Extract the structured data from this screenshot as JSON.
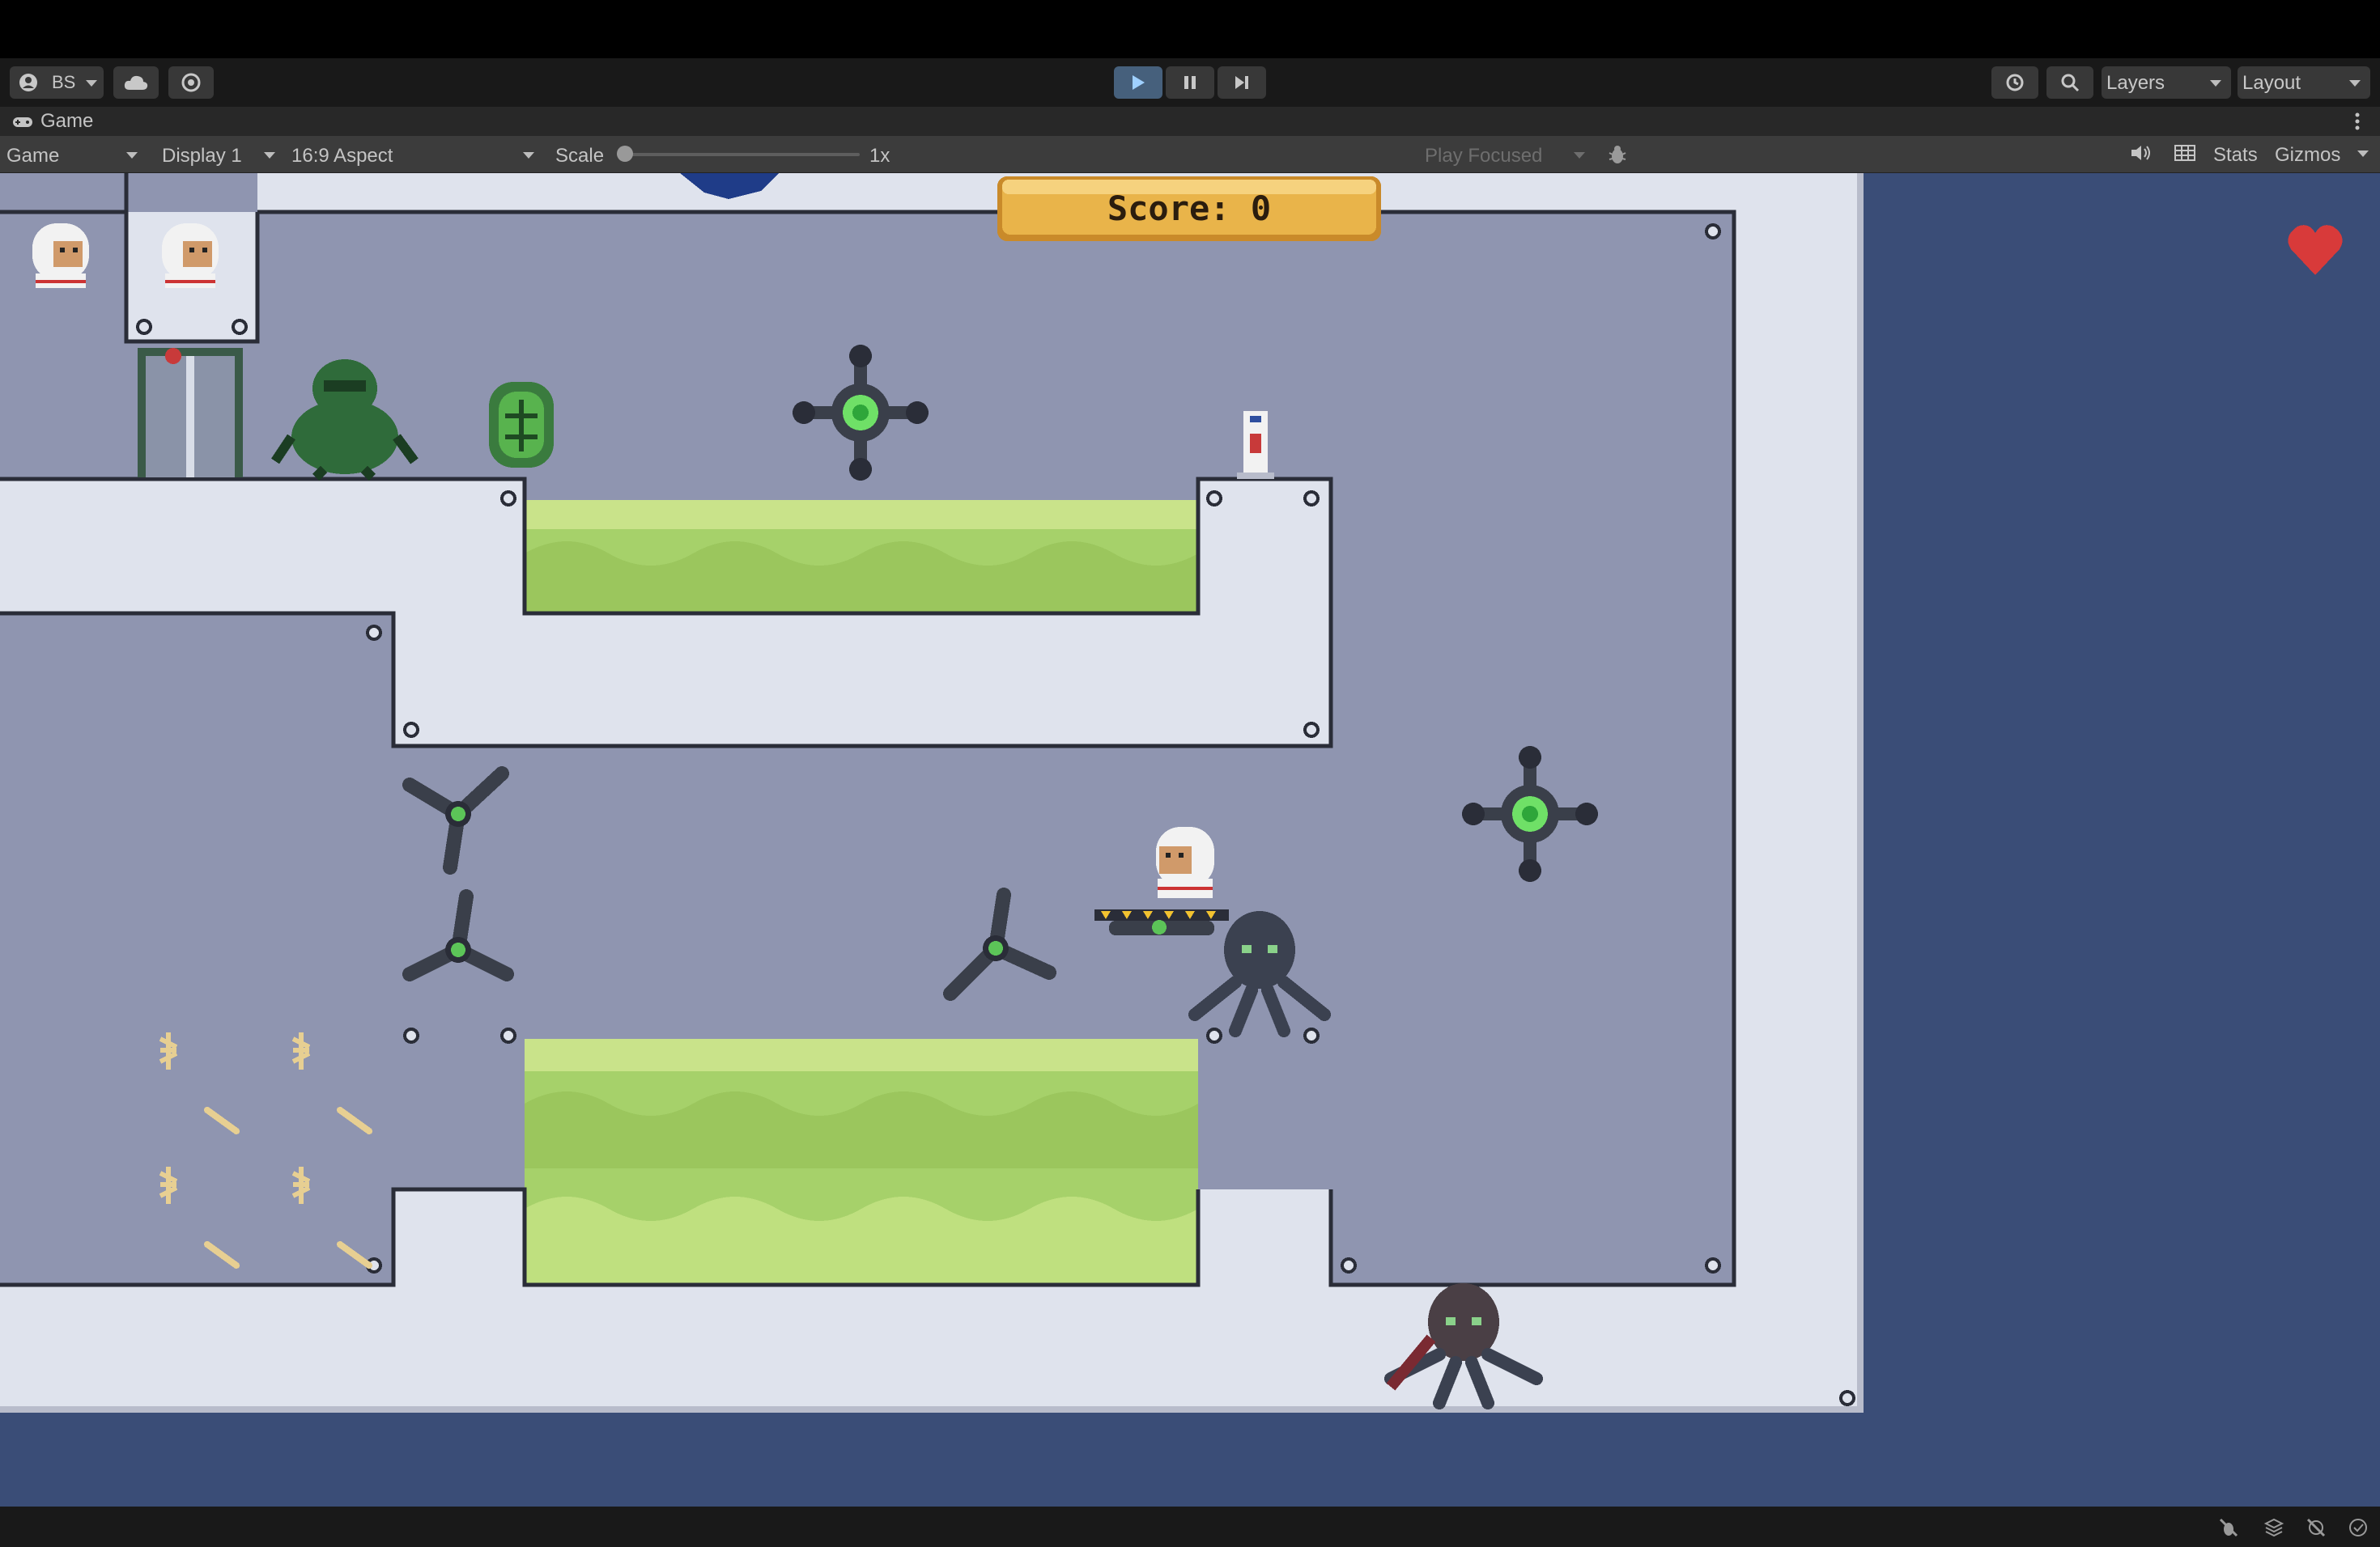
{
  "toolbar": {
    "account_label": "BS",
    "layers_label": "Layers",
    "layout_label": "Layout"
  },
  "tab": {
    "title": "Game"
  },
  "controls": {
    "view_select": "Game",
    "display_select": "Display 1",
    "aspect_select": "16:9 Aspect",
    "scale_label": "Scale",
    "scale_value": "1x",
    "play_focus_select": "Play Focused",
    "stats_label": "Stats",
    "gizmos_label": "Gizmos"
  },
  "game": {
    "score_text": "Score: 0",
    "lives": 1
  },
  "colors": {
    "wall": "#dfe3ed",
    "room": "#8f95b0",
    "acid": "#a6d16a",
    "backdrop": "#3a4d77",
    "score_banner": "#e9b44a"
  }
}
